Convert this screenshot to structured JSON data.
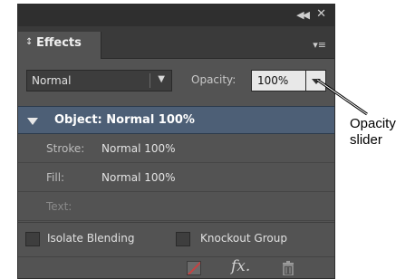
{
  "panel": {
    "tab_arrows": "↕",
    "tab_label": "Effects",
    "collapse_icon": "◀◀",
    "close_icon": "✕",
    "menu_icon": "▾≡"
  },
  "blend": {
    "mode": "Normal",
    "opacity_label": "Opacity:",
    "opacity_value": "100%"
  },
  "targets": {
    "object": "Object: Normal 100%",
    "stroke_label": "Stroke:",
    "stroke_value": "Normal 100%",
    "fill_label": "Fill:",
    "fill_value": "Normal 100%",
    "text_label": "Text:"
  },
  "options": {
    "isolate_blending": "Isolate Blending",
    "knockout_group": "Knockout Group"
  },
  "icons": {
    "fx": "fx."
  },
  "callout": {
    "line1": "Opacity",
    "line2": "slider"
  }
}
